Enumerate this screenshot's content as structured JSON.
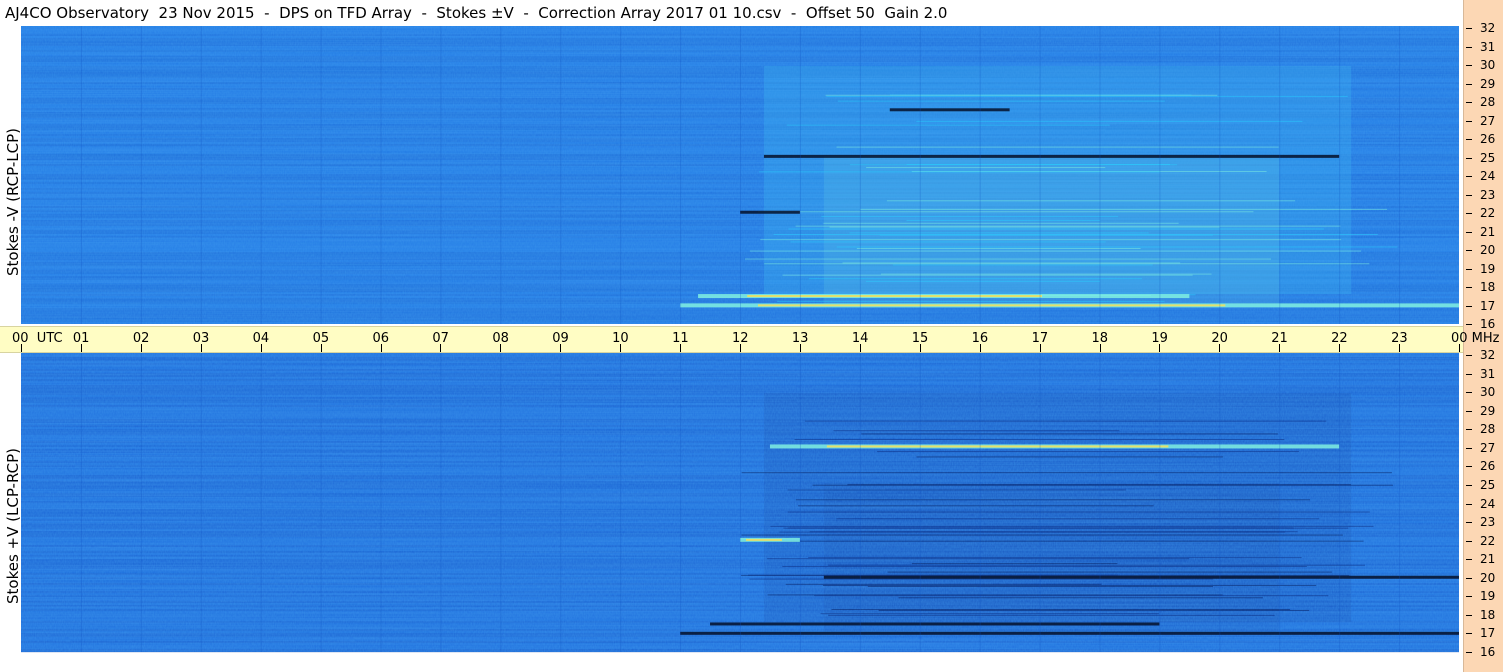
{
  "title": "AJ4CO Observatory  23 Nov 2015  -  DPS on TFD Array  -  Stokes ±V  -  Correction Array 2017 01 10.csv  -  Offset 50  Gain 2.0",
  "panels": {
    "top_label": "Stokes -V (RCP-LCP)",
    "bottom_label": "Stokes +V (LCP-RCP)"
  },
  "utc_axis": {
    "labels": [
      "00  UTC",
      "01",
      "02",
      "03",
      "04",
      "05",
      "06",
      "07",
      "08",
      "09",
      "10",
      "11",
      "12",
      "13",
      "14",
      "15",
      "16",
      "17",
      "18",
      "19",
      "20",
      "21",
      "22",
      "23",
      "00 MHz"
    ]
  },
  "freq_axis": {
    "labels": [
      "32",
      "31",
      "30",
      "29",
      "28",
      "27",
      "26",
      "25",
      "24",
      "23",
      "22",
      "21",
      "20",
      "19",
      "18",
      "17",
      "16"
    ]
  },
  "colors": {
    "background_blue": "#1a6fe0",
    "deep_blue": "#0d3fa8",
    "cyan": "#3bc8f0",
    "bright": "#80f0e0",
    "yellow_streak": "#f0e060",
    "black_streak": "#05102a",
    "utc_bar": "#fffdc4",
    "freq_strip": "#fcd7b4"
  },
  "chart_data": [
    {
      "type": "heatmap",
      "title": "Stokes -V (RCP-LCP)",
      "x_axis": "UTC hour",
      "xlim": [
        0,
        24
      ],
      "y_axis": "MHz",
      "ylim": [
        16,
        32
      ],
      "features": [
        {
          "band_mhz": 17.5,
          "start_utc": 11.3,
          "end_utc": 19.5,
          "kind": "bright"
        },
        {
          "band_mhz": 17,
          "start_utc": 11.0,
          "end_utc": 24,
          "kind": "bright"
        },
        {
          "band_mhz": 22,
          "start_utc": 12.0,
          "end_utc": 13.0,
          "kind": "dark"
        },
        {
          "band_mhz": 25,
          "start_utc": 12.4,
          "end_utc": 22.0,
          "kind": "dark"
        },
        {
          "band_mhz": 27.5,
          "start_utc": 14.5,
          "end_utc": 16.5,
          "kind": "dark"
        }
      ]
    },
    {
      "type": "heatmap",
      "title": "Stokes +V (LCP-RCP)",
      "x_axis": "UTC hour",
      "xlim": [
        0,
        24
      ],
      "y_axis": "MHz",
      "ylim": [
        16,
        32
      ],
      "features": [
        {
          "band_mhz": 17,
          "start_utc": 11.0,
          "end_utc": 24,
          "kind": "dark"
        },
        {
          "band_mhz": 17.5,
          "start_utc": 11.5,
          "end_utc": 19.0,
          "kind": "dark"
        },
        {
          "band_mhz": 20,
          "start_utc": 13.4,
          "end_utc": 24,
          "kind": "dark"
        },
        {
          "band_mhz": 22,
          "start_utc": 12.0,
          "end_utc": 13.0,
          "kind": "bright"
        },
        {
          "band_mhz": 27,
          "start_utc": 12.5,
          "end_utc": 22.0,
          "kind": "bright"
        }
      ]
    }
  ]
}
